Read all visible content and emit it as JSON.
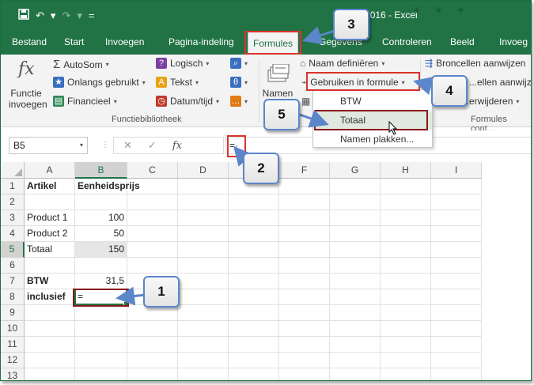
{
  "titlebar": {
    "title": "...den2016 - Excel",
    "qat": {
      "save_icon": "save-icon",
      "undo_icon": "undo-icon",
      "redo_icon": "redo-icon",
      "more": "="
    }
  },
  "tabs": [
    {
      "label": "Bestand",
      "active": false
    },
    {
      "label": "Start",
      "active": false
    },
    {
      "label": "Invoegen",
      "active": false
    },
    {
      "label": "Pagina-indeling",
      "active": false
    },
    {
      "label": "Formules",
      "active": true
    },
    {
      "label": "Gegevens",
      "active": false
    },
    {
      "label": "Controleren",
      "active": false
    },
    {
      "label": "Beeld",
      "active": false
    },
    {
      "label": "Invoeg",
      "active": false
    }
  ],
  "ribbon": {
    "insert_function": {
      "line1": "Functie",
      "line2": "invoegen"
    },
    "library": {
      "autosum": "AutoSom",
      "recent": "Onlangs gebruikt",
      "financial": "Financieel",
      "logical": "Logisch",
      "text": "Tekst",
      "datetime": "Datum/tijd",
      "group_label": "Functiebibliotheek"
    },
    "names": {
      "names_label": "Namen",
      "define_name": "Naam definiëren",
      "use_in_formula": "Gebruiken in formule",
      "dropdown": [
        "BTW",
        "Totaal",
        "Namen plakken..."
      ]
    },
    "audit": {
      "trace_precedents": "Broncellen aanwijzen",
      "trace_dependents": "...ellen aanwijzen",
      "remove": "...erwijderen",
      "group_label": "Formules cont..."
    }
  },
  "formula_bar": {
    "name_box": "B5",
    "cancel": "✕",
    "enter": "✓",
    "fx": "fx",
    "value": "=·"
  },
  "sheet": {
    "columns": [
      "A",
      "B",
      "C",
      "D",
      "E",
      "F",
      "G",
      "H",
      "I"
    ],
    "rows": [
      "1",
      "2",
      "3",
      "4",
      "5",
      "6",
      "7",
      "8",
      "9",
      "10",
      "11",
      "12",
      "13"
    ],
    "cells": {
      "A1": "Artikel",
      "B1": "Eenheidsprijs",
      "A3": "Product 1",
      "B3": "100",
      "A4": "Product 2",
      "B4": "50",
      "A5": "Totaal",
      "B5": "150",
      "A7": "BTW",
      "B7": "31,5",
      "A8": "inclusief",
      "B8": "="
    },
    "active_cell": "B8"
  },
  "callouts": [
    "1",
    "2",
    "3",
    "4",
    "5"
  ],
  "colors": {
    "excel_green": "#217346",
    "annotation_red": "#d9342b",
    "callout_border": "#5b86c9"
  }
}
